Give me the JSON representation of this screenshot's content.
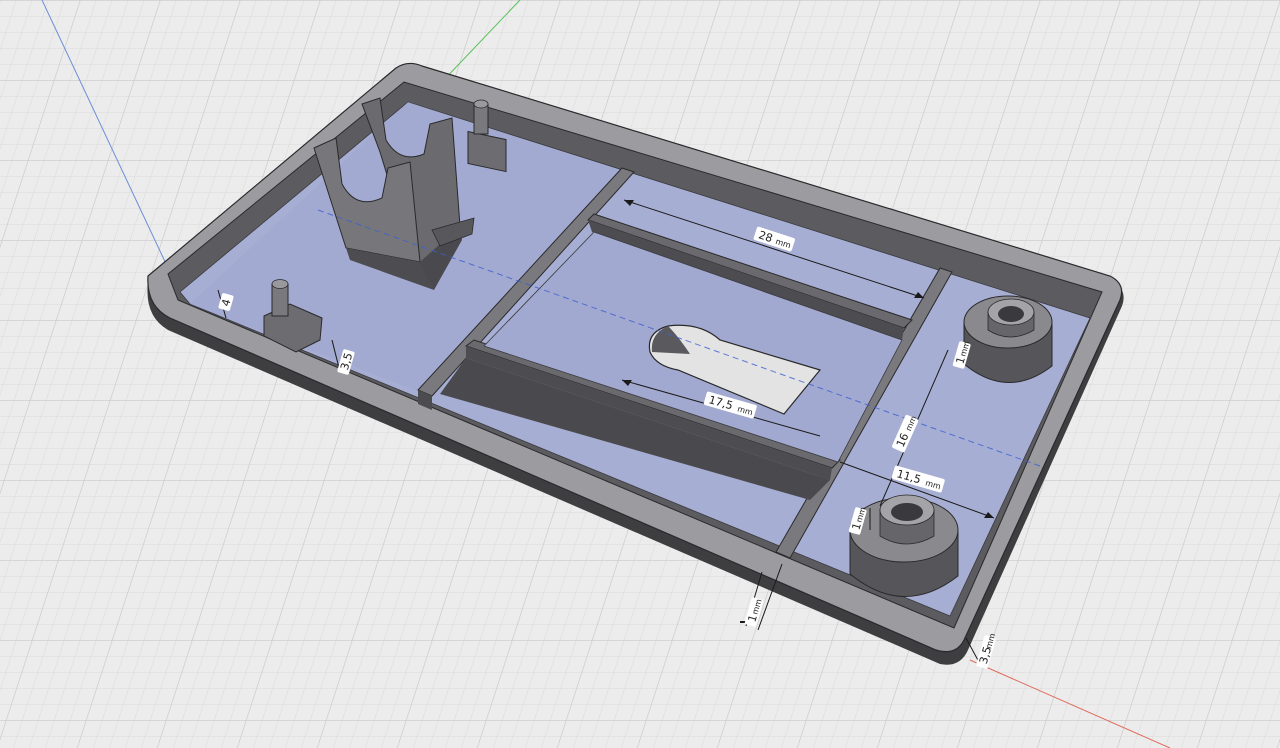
{
  "scene": {
    "part": "tray",
    "view": "isometric",
    "grid": true,
    "axes": [
      "x",
      "y",
      "z"
    ],
    "colors": {
      "background": "#ececec",
      "grid_minor": "#d9d9d9",
      "grid_major": "#c9c9c9",
      "axis_x": "#e06a5a",
      "axis_y": "#58c158",
      "axis_z": "#6b8fd6",
      "body_dark": "#4a4a4d",
      "body_mid": "#6d6d70",
      "body_top": "#a4a4a8",
      "floor": "#a9afd2",
      "floor_shade": "#8f96c0",
      "dimension_line": "#1a1a1a",
      "dimension_label_bg": "#ffffff"
    }
  },
  "dimensions": {
    "d28": {
      "value": "28",
      "unit": "mm"
    },
    "d17_5": {
      "value": "17,5",
      "unit": "mm"
    },
    "d16": {
      "value": "16",
      "unit": "mm"
    },
    "d11_5": {
      "value": "11,5",
      "unit": "mm"
    },
    "d1_boss_top": {
      "value": "1",
      "unit": "mm"
    },
    "d1_boss_bottom": {
      "value": "1",
      "unit": "mm"
    },
    "d1_front": {
      "value": "1",
      "unit": "mm"
    },
    "d3_5_corner": {
      "value": "3,5",
      "unit": "mm"
    },
    "d3_5_left": {
      "value": "3,5",
      "unit": ""
    },
    "d_left_small": {
      "value": "4",
      "unit": ""
    }
  }
}
